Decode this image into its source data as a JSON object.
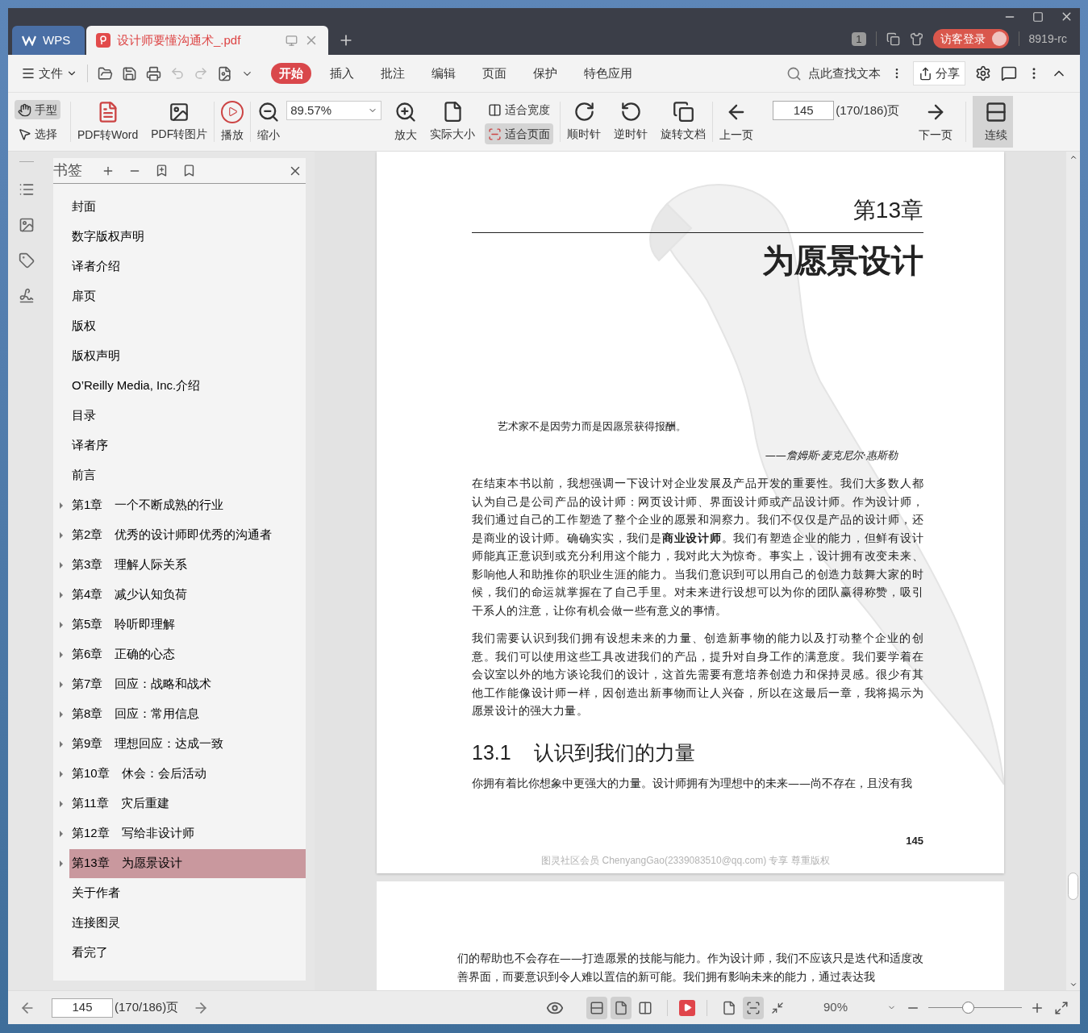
{
  "title_bar": {
    "tabs": [
      {
        "label": "WPS",
        "selected": false
      },
      {
        "label": "设计师要懂沟通术_.pdf",
        "selected": true
      }
    ],
    "badge": "1",
    "login": "访客登录",
    "user": "8919-rc"
  },
  "menu_bar": {
    "file": "文件",
    "tabs": [
      {
        "label": "开始",
        "selected": true
      },
      {
        "label": "插入",
        "selected": false
      },
      {
        "label": "批注",
        "selected": false
      },
      {
        "label": "编辑",
        "selected": false
      },
      {
        "label": "页面",
        "selected": false
      },
      {
        "label": "保护",
        "selected": false
      },
      {
        "label": "特色应用",
        "selected": false
      }
    ],
    "search": "点此查找文本",
    "share": "分享"
  },
  "toolbar": {
    "select_tools": [
      {
        "label": "手型",
        "selected": true
      },
      {
        "label": "选择",
        "selected": false
      }
    ],
    "convert_buttons": [
      "PDF转Word",
      "PDF转图片"
    ],
    "play": "播放",
    "zoom_out": "缩小",
    "zoom_value": "89.57%",
    "zoom_in": "放大",
    "actual_size": "实际大小",
    "fit_modes": [
      {
        "label": "适合宽度",
        "selected": false
      },
      {
        "label": "适合页面",
        "selected": true
      }
    ],
    "rotate_buttons": [
      "顺时针",
      "逆时针",
      "旋转文档"
    ],
    "prev_page": "上一页",
    "page_value": "145",
    "page_count": "(170/186)页",
    "next_page": "下一页",
    "continuous": "连续"
  },
  "sidebar": {
    "title": "书签",
    "bookmarks": [
      {
        "label": "封面",
        "expandable": false,
        "selected": false
      },
      {
        "label": "数字版权声明",
        "expandable": false,
        "selected": false
      },
      {
        "label": "译者介绍",
        "expandable": false,
        "selected": false
      },
      {
        "label": "扉页",
        "expandable": false,
        "selected": false
      },
      {
        "label": "版权",
        "expandable": false,
        "selected": false
      },
      {
        "label": "版权声明",
        "expandable": false,
        "selected": false
      },
      {
        "label": "O’Reilly Media, Inc.介绍",
        "expandable": false,
        "selected": false
      },
      {
        "label": "目录",
        "expandable": false,
        "selected": false
      },
      {
        "label": "译者序",
        "expandable": false,
        "selected": false
      },
      {
        "label": "前言",
        "expandable": false,
        "selected": false
      },
      {
        "label": "第1章　一个不断成熟的行业",
        "expandable": true,
        "selected": false
      },
      {
        "label": "第2章　优秀的设计师即优秀的沟通者",
        "expandable": true,
        "selected": false
      },
      {
        "label": "第3章　理解人际关系",
        "expandable": true,
        "selected": false
      },
      {
        "label": "第4章　减少认知负荷",
        "expandable": true,
        "selected": false
      },
      {
        "label": "第5章　聆听即理解",
        "expandable": true,
        "selected": false
      },
      {
        "label": "第6章　正确的心态",
        "expandable": true,
        "selected": false
      },
      {
        "label": "第7章　回应：战略和战术",
        "expandable": true,
        "selected": false
      },
      {
        "label": "第8章　回应：常用信息",
        "expandable": true,
        "selected": false
      },
      {
        "label": "第9章　理想回应：达成一致",
        "expandable": true,
        "selected": false
      },
      {
        "label": "第10章　休会：会后活动",
        "expandable": true,
        "selected": false
      },
      {
        "label": "第11章　灾后重建",
        "expandable": true,
        "selected": false
      },
      {
        "label": "第12章　写给非设计师",
        "expandable": true,
        "selected": false
      },
      {
        "label": "第13章　为愿景设计",
        "expandable": true,
        "selected": true
      },
      {
        "label": "关于作者",
        "expandable": false,
        "selected": false
      },
      {
        "label": "连接图灵",
        "expandable": false,
        "selected": false
      },
      {
        "label": "看完了",
        "expandable": false,
        "selected": false
      }
    ]
  },
  "page": {
    "chapter_label": "第13章",
    "chapter_title": "为愿景设计",
    "epigraph": "艺术家不是因劳力而是因愿景获得报酬。",
    "attribution": "——詹姆斯·麦克尼尔·惠斯勒",
    "paragraphs": [
      "在结束本书以前，我想强调一下设计对企业发展及产品开发的重要性。我们大多数人都认为自己是公司产品的设计师：网页设计师、界面设计师或产品设计师。作为设计师，我们通过自己的工作塑造了整个企业的愿景和洞察力。我们不仅仅是产品的设计师，还是商业的设计师。确确实实，我们是**商业设计师**。我们有塑造企业的能力，但鲜有设计师能真正意识到或充分利用这个能力，我对此大为惊奇。事实上，设计拥有改变未来、影响他人和助推你的职业生涯的能力。当我们意识到可以用自己的创造力鼓舞大家的时候，我们的命运就掌握在了自己手里。对未来进行设想可以为你的团队赢得称赞，吸引干系人的注意，让你有机会做一些有意义的事情。",
      "我们需要认识到我们拥有设想未来的力量、创造新事物的能力以及打动整个企业的创意。我们可以使用这些工具改进我们的产品，提升对自身工作的满意度。我们要学着在会议室以外的地方谈论我们的设计，这首先需要有意培养创造力和保持灵感。很少有其他工作能像设计师一样，因创造出新事物而让人兴奋，所以在这最后一章，我将揭示为愿景设计的强大力量。"
    ],
    "section_number": "13.1",
    "section_title": "认识到我们的力量",
    "section_paragraph": "你拥有着比你想象中更强大的力量。设计师拥有为理想中的未来——尚不存在，且没有我",
    "page_number": "145",
    "footer": "图灵社区会员 ChenyangGao(2339083510@qq.com) 专享 尊重版权"
  },
  "next_page": {
    "paragraph": "们的帮助也不会存在——打造愿景的技能与能力。作为设计师，我们不应该只是迭代和适度改善界面，而要意识到令人难以置信的新可能。我们拥有影响未来的能力，通过表达我"
  },
  "status_bar": {
    "page_value": "145",
    "page_count": "(170/186)页",
    "layout_modes": [
      {
        "selected": true
      },
      {
        "selected": true
      },
      {
        "selected": false
      }
    ],
    "fit_modes": [
      {
        "selected": false
      },
      {
        "selected": true
      },
      {
        "selected": false
      }
    ],
    "zoom": "90%",
    "zoom_slider": {
      "level": 0.42
    }
  }
}
